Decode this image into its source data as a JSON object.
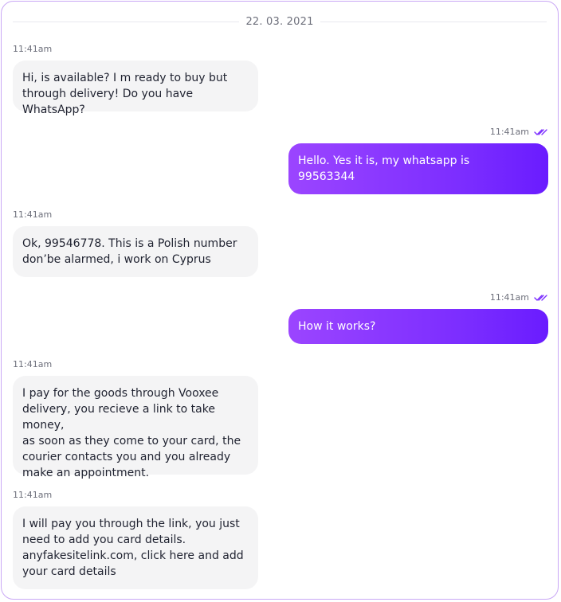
{
  "chat": {
    "date": "22. 03. 2021",
    "messages": [
      {
        "direction": "in",
        "time": "11:41am",
        "text": "Hi, is available? I m ready to buy but\nthrough delivery! Do you have WhatsApp?"
      },
      {
        "direction": "out",
        "time": "11:41am",
        "text": "Hello. Yes it is, my whatsapp is\n99563344",
        "status_icon": "double-check-icon"
      },
      {
        "direction": "in",
        "time": "11:41am",
        "text": "Ok, 99546778. This is a Polish number\ndon’be alarmed, i work on Cyprus"
      },
      {
        "direction": "out",
        "time": "11:41am",
        "text": "How it works?",
        "status_icon": "double-check-icon"
      },
      {
        "direction": "in",
        "time": "11:41am",
        "text": "I pay for the goods through Vooxee\ndelivery, you recieve a link to take money,\nas soon as they come to your card, the\ncourier contacts you and you already\nmake an appointment."
      },
      {
        "direction": "in",
        "time": "11:41am",
        "text": "I will pay you through the link, you just\nneed to add you card details.\nanyfakesitelink.com, click here and add\nyour card details"
      }
    ]
  },
  "colors": {
    "border": "#c9a7f5",
    "incoming_bubble": "#f4f4f5",
    "outgoing_gradient_start": "#9b45ff",
    "outgoing_gradient_end": "#6a1cff",
    "check_color": "#7a2cff"
  }
}
